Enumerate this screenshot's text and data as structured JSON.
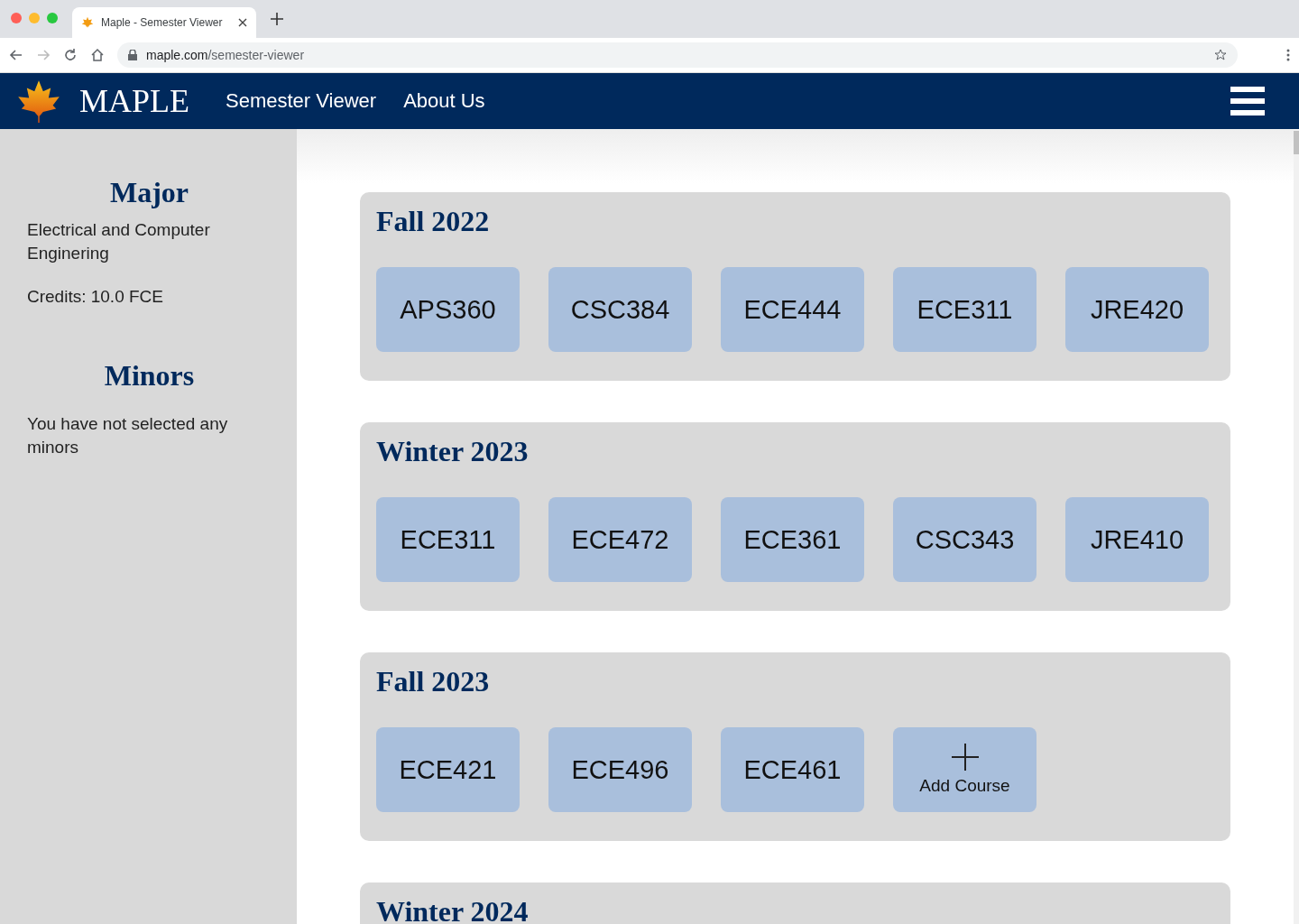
{
  "browser": {
    "tab_title": "Maple - Semester Viewer",
    "url_host": "maple.com",
    "url_path": "/semester-viewer"
  },
  "navbar": {
    "brand": "MAPLE",
    "links": [
      "Semester Viewer",
      "About Us"
    ]
  },
  "sidebar": {
    "major_heading": "Major",
    "major": "Electrical and Computer Enginering",
    "credits": "Credits: 10.0 FCE",
    "minors_heading": "Minors",
    "minors_text": "You have not selected any minors"
  },
  "semesters": [
    {
      "title": "Fall 2022",
      "courses": [
        {
          "kind": "course",
          "label": "APS360"
        },
        {
          "kind": "course",
          "label": "CSC384"
        },
        {
          "kind": "course",
          "label": "ECE444"
        },
        {
          "kind": "course",
          "label": "ECE311"
        },
        {
          "kind": "course",
          "label": "JRE420"
        }
      ]
    },
    {
      "title": "Winter 2023",
      "courses": [
        {
          "kind": "course",
          "label": "ECE311"
        },
        {
          "kind": "course",
          "label": "ECE472"
        },
        {
          "kind": "course",
          "label": "ECE361"
        },
        {
          "kind": "course",
          "label": "CSC343"
        },
        {
          "kind": "course",
          "label": "JRE410"
        }
      ]
    },
    {
      "title": "Fall 2023",
      "courses": [
        {
          "kind": "course",
          "label": "ECE421"
        },
        {
          "kind": "course",
          "label": "ECE496"
        },
        {
          "kind": "course",
          "label": "ECE461"
        },
        {
          "kind": "add",
          "label": "Add Course"
        }
      ]
    },
    {
      "title": "Winter 2024"
    }
  ]
}
